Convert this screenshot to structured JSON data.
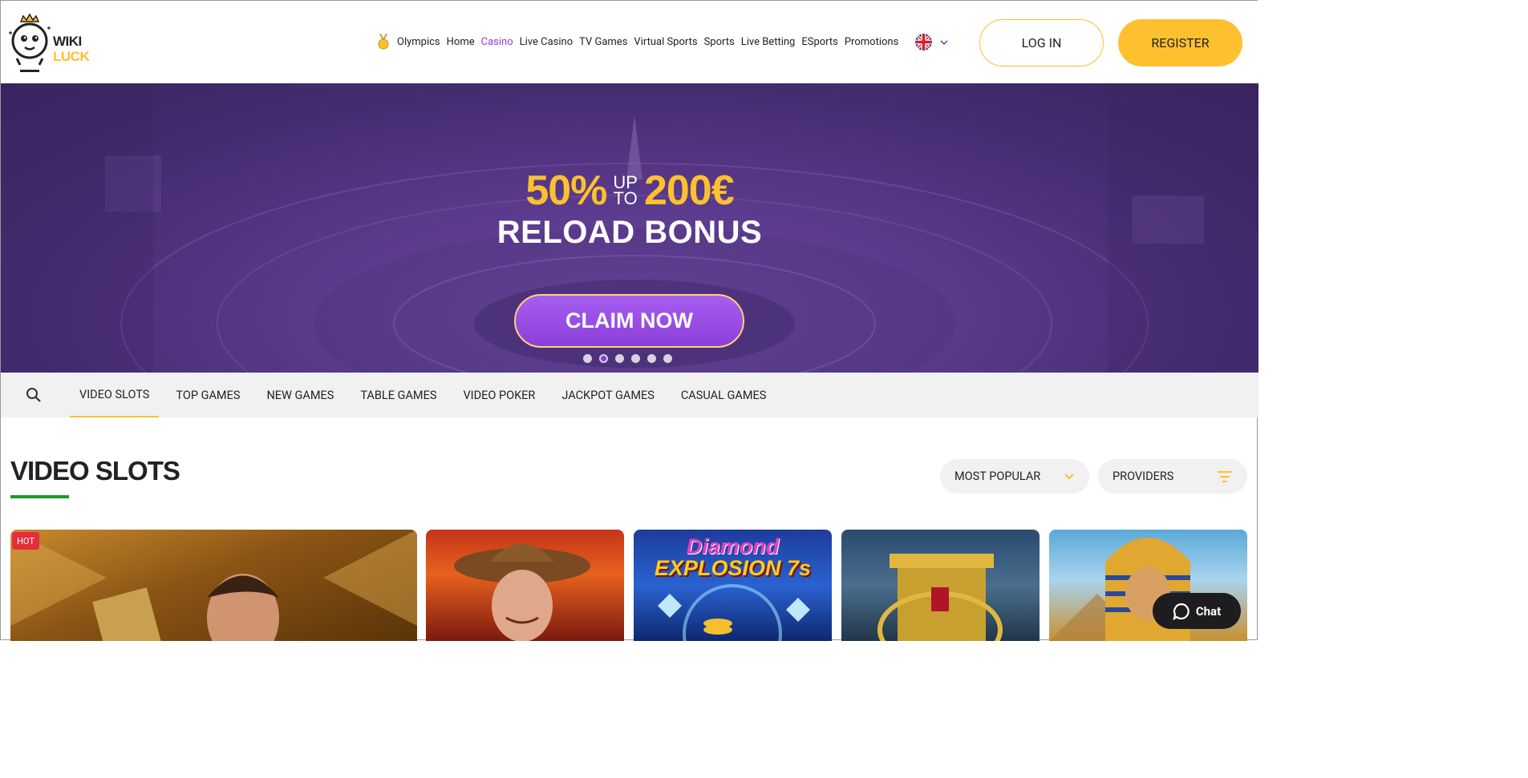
{
  "header": {
    "logo": {
      "line1": "WIKI",
      "line2": "LUCK"
    },
    "nav": [
      {
        "label": "Olympics",
        "active": false
      },
      {
        "label": "Home",
        "active": false
      },
      {
        "label": "Casino",
        "active": true
      },
      {
        "label": "Live Casino",
        "active": false
      },
      {
        "label": "TV Games",
        "active": false
      },
      {
        "label": "Virtual Sports",
        "active": false
      },
      {
        "label": "Sports",
        "active": false
      },
      {
        "label": "Live Betting",
        "active": false
      },
      {
        "label": "ESports",
        "active": false
      },
      {
        "label": "Promotions",
        "active": false
      }
    ],
    "language_icon": "uk-flag-icon",
    "login_label": "LOG IN",
    "register_label": "REGISTER"
  },
  "banner": {
    "percent": "50%",
    "up": "UP",
    "to": "TO",
    "amount": "200€",
    "headline": "RELOAD BONUS",
    "cta": "CLAIM NOW",
    "slides_count": 6,
    "active_slide": 2
  },
  "categories": {
    "search_icon": "search-icon",
    "items": [
      "VIDEO SLOTS",
      "TOP GAMES",
      "NEW GAMES",
      "TABLE GAMES",
      "VIDEO POKER",
      "JACKPOT GAMES",
      "CASUAL GAMES"
    ],
    "active": "VIDEO SLOTS"
  },
  "section": {
    "title": "VIDEO SLOTS",
    "sort_label": "MOST POPULAR",
    "providers_label": "PROVIDERS"
  },
  "games": [
    {
      "badge": "HOT"
    },
    {
      "badge": ""
    },
    {
      "title_line1": "Diamond",
      "title_line2": "EXPLOSION 7s"
    },
    {
      "badge": ""
    },
    {
      "badge": ""
    }
  ],
  "chat": {
    "label": "Chat"
  },
  "colors": {
    "accent_yellow": "#fdc02f",
    "accent_purple": "#8b3fd9",
    "underline_green": "#1a9a2c",
    "hot_red": "#e52d3c"
  }
}
